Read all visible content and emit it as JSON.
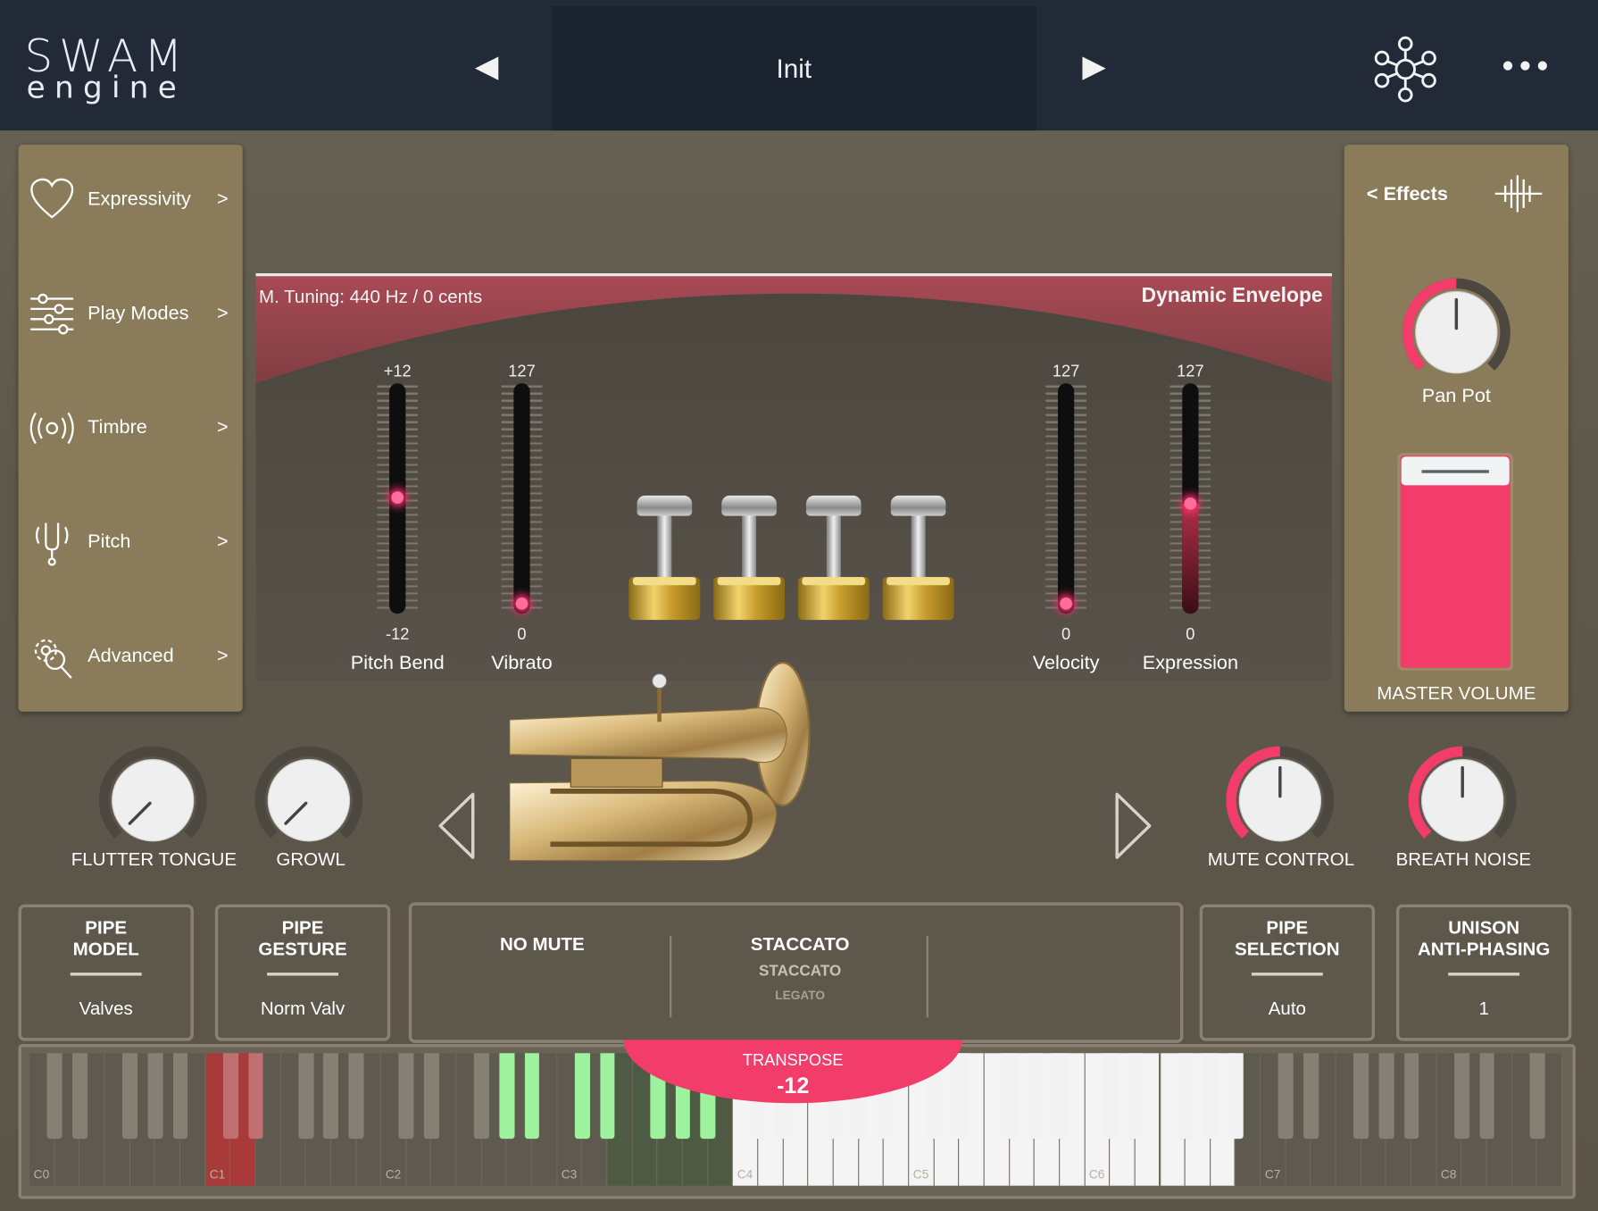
{
  "header": {
    "logo_line1": "SWAM",
    "logo_line2": "engine",
    "preset_name": "Init",
    "prev_icon": "◀",
    "next_icon": "▶"
  },
  "sidebar": {
    "items": [
      {
        "label": "Expressivity",
        "arrow": ">",
        "icon": "heart-icon"
      },
      {
        "label": "Play Modes",
        "arrow": ">",
        "icon": "sliders-icon"
      },
      {
        "label": "Timbre",
        "arrow": ">",
        "icon": "radiate-icon"
      },
      {
        "label": "Pitch",
        "arrow": ">",
        "icon": "tuning-fork-icon"
      },
      {
        "label": "Advanced",
        "arrow": ">",
        "icon": "gear-search-icon"
      }
    ]
  },
  "effects_panel": {
    "back_label": "< Effects",
    "pan_pot_label": "Pan Pot",
    "pan_pot_value": 0.5,
    "master_volume_label": "MASTER VOLUME",
    "master_volume_value": 1.0
  },
  "center": {
    "tuning_label": "M. Tuning: 440 Hz / 0 cents",
    "dynamic_envelope_label": "Dynamic Envelope",
    "sliders": [
      {
        "name": "Pitch Bend",
        "max": "+12",
        "min": "-12",
        "value": 0.5
      },
      {
        "name": "Vibrato",
        "max": "127",
        "min": "0",
        "value": 0.0
      },
      {
        "name": "Velocity",
        "max": "127",
        "min": "0",
        "value": 0.0
      },
      {
        "name": "Expression",
        "max": "127",
        "min": "0",
        "value": 0.47
      }
    ]
  },
  "knobs": [
    {
      "label": "FLUTTER TONGUE",
      "value": 0.0
    },
    {
      "label": "GROWL",
      "value": 0.0
    },
    {
      "label": "MUTE CONTROL",
      "value": 0.5
    },
    {
      "label": "BREATH NOISE",
      "value": 0.5
    }
  ],
  "selectors": {
    "pipe_model": {
      "title1": "PIPE",
      "title2": "MODEL",
      "value": "Valves"
    },
    "pipe_gesture": {
      "title1": "PIPE",
      "title2": "GESTURE",
      "value": "Norm Valv"
    },
    "pipe_selection": {
      "title1": "PIPE",
      "title2": "SELECTION",
      "value": "Auto"
    },
    "unison": {
      "title1": "UNISON",
      "title2": "ANTI-PHASING",
      "value": "1"
    }
  },
  "mute_box": {
    "mute_label": "NO MUTE",
    "articulation_selected": "STACCATO",
    "articulation_option1": "STACCATO",
    "articulation_option2": "LEGATO"
  },
  "transpose": {
    "label": "TRANSPOSE",
    "value": "-12"
  },
  "keyboard": {
    "octave_labels": [
      "C0",
      "C1",
      "C2",
      "C3",
      "C4",
      "C5",
      "C6",
      "C7",
      "C8"
    ],
    "colors": {
      "accent": "#f23d6a",
      "green": "#9ef29e",
      "red": "#a83a3a"
    }
  }
}
